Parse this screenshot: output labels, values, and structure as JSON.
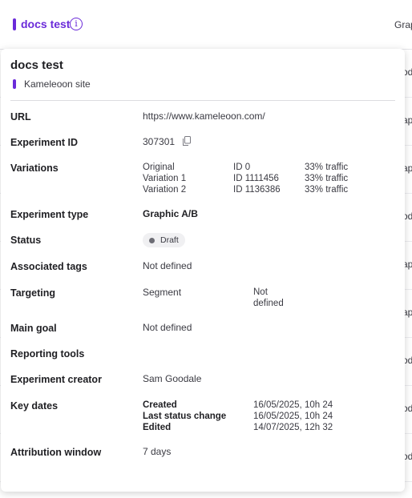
{
  "header": {
    "experiment_name": "docs test",
    "info_icon": "info-icon",
    "column_partial": "Grap"
  },
  "rows_partial": [
    "od",
    "ap",
    "ap",
    "od",
    "ap",
    "ap",
    "od",
    "od",
    "od"
  ],
  "popover": {
    "title": "docs test",
    "site": "Kameleoon site",
    "url_label": "URL",
    "url_value": "https://www.kameleoon.com/",
    "id_label": "Experiment ID",
    "id_value": "307301",
    "variations_label": "Variations",
    "variations": [
      {
        "name": "Original",
        "id": "ID 0",
        "traffic": "33% traffic"
      },
      {
        "name": "Variation 1",
        "id": "ID 1111456",
        "traffic": "33% traffic"
      },
      {
        "name": "Variation 2",
        "id": "ID 1136386",
        "traffic": "33% traffic"
      }
    ],
    "type_label": "Experiment type",
    "type_value": "Graphic A/B",
    "status_label": "Status",
    "status_value": "Draft",
    "tags_label": "Associated tags",
    "tags_value": "Not defined",
    "targeting_label": "Targeting",
    "targeting_key": "Segment",
    "targeting_value_line1": "Not",
    "targeting_value_line2": "defined",
    "goal_label": "Main goal",
    "goal_value": "Not defined",
    "reporting_label": "Reporting tools",
    "creator_label": "Experiment creator",
    "creator_value": "Sam Goodale",
    "dates_label": "Key dates",
    "dates": [
      {
        "label": "Created",
        "value": "16/05/2025, 10h 24"
      },
      {
        "label": "Last status change",
        "value": "16/05/2025, 10h 24"
      },
      {
        "label": "Edited",
        "value": "14/07/2025, 12h 32"
      }
    ],
    "attribution_label": "Attribution window",
    "attribution_value": "7 days"
  },
  "colors": {
    "accent": "#6b2bd9",
    "status_dot": "#6c6c74"
  }
}
